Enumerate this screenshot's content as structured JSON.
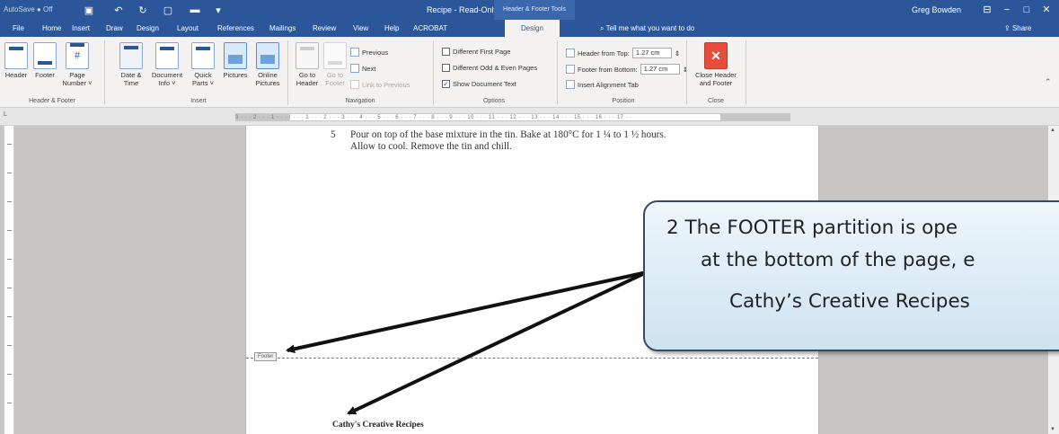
{
  "titlebar": {
    "autosave": "AutoSave  ● Off",
    "doc_title": "Recipe  -  Read-Only",
    "context_label": "Header & Footer Tools",
    "user": "Greg Bowden"
  },
  "tabs": [
    "File",
    "Home",
    "Insert",
    "Draw",
    "Design",
    "Layout",
    "References",
    "Mailings",
    "Review",
    "View",
    "Help",
    "ACROBAT",
    "Design"
  ],
  "tell_me": "Tell me what you want to do",
  "share": "Share",
  "ribbon": {
    "header_footer": {
      "header": "Header",
      "footer": "Footer",
      "page_number": "Page\nNumber ˅",
      "label": "Header & Footer"
    },
    "insert": {
      "date_time": "Date &\nTime",
      "doc_info": "Document\nInfo ˅",
      "quick_parts": "Quick\nParts ˅",
      "pictures": "Pictures",
      "online_pictures": "Online\nPictures",
      "label": "Insert"
    },
    "navigation": {
      "go_to_header": "Go to\nHeader",
      "go_to_footer": "Go to\nFooter",
      "previous": "Previous",
      "next": "Next",
      "link_to_previous": "Link to Previous",
      "label": "Navigation"
    },
    "options": {
      "different_first_page": "Different First Page",
      "different_odd_even": "Different Odd & Even Pages",
      "show_document_text": "Show Document Text",
      "label": "Options"
    },
    "position": {
      "header_from_top": "Header from Top:",
      "header_value": "1.27 cm",
      "footer_from_bottom": "Footer from Bottom:",
      "footer_value": "1.27 cm",
      "insert_alignment_tab": "Insert Alignment Tab",
      "label": "Position"
    },
    "close": {
      "close_header_footer": "Close Header\nand Footer",
      "label": "Close"
    }
  },
  "ruler_text": "3 · · · 2 · · · 1 · · · | · · · 1 · · · 2 · · · 3 · · · 4 · · · 5 · · · 6 · · · 7 · · · 8 · · · 9 · · · 10 · · · 11 · · · 12 · · · 13 · · · 14 · · · 15 · · · 16 · · · 17 · ·",
  "document": {
    "step_number": "5",
    "step_line1": "Pour on top of the base mixture in the tin.  Bake at 180°C for 1 ¼ to 1 ½ hours.",
    "step_line2": "Allow to cool.  Remove the tin and chill.",
    "footer_tag": "Footer",
    "footer_text": "Cathy's Creative Recipes"
  },
  "callout": {
    "line1": "2  The FOOTER partition is ope",
    "line2": "at the bottom of the page, e",
    "line3": "Cathy’s Creative Recipes"
  },
  "colors": {
    "word_blue": "#2b579a",
    "ribbon_bg": "#f3f2f1",
    "close_red": "#e84c3d",
    "callout_border": "#3a4a5c"
  }
}
